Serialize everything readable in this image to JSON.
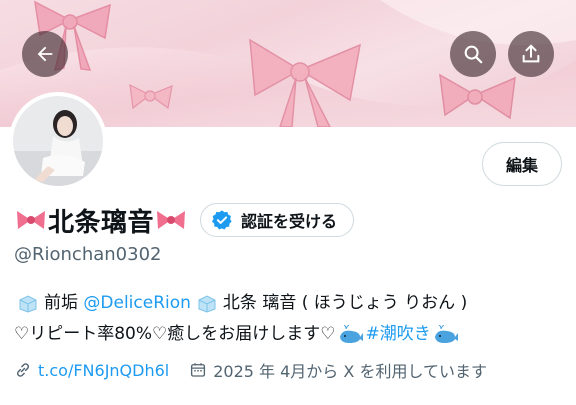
{
  "header": {
    "back_icon": "arrow-left-icon",
    "search_icon": "search-icon",
    "share_icon": "share-icon"
  },
  "profile": {
    "display_name": "北条璃音",
    "name_decoration_icon": "ribbon-bow-emoji",
    "edit_label": "編集",
    "verify_label": "認証を受ける",
    "handle": "@Rionchan0302"
  },
  "bio": {
    "line1_prefix": "前垢",
    "line1_mention": "@DeliceRion",
    "line1_suffix": "北条 璃音 ( ほうじょう りおん )",
    "line2_text": "♡リピート率80%♡癒しをお届けします♡",
    "line2_hashtag": "#潮吹き",
    "ice_emoji": "ice-cube-emoji",
    "whale_emoji": "whale-emoji"
  },
  "meta": {
    "link_text": "t.co/FN6JnQDh6l",
    "joined_text": "2025 年 4月から X を利用しています"
  },
  "colors": {
    "accent": "#1d9bf0",
    "secondary_text": "#536471",
    "banner_pink": "#f3d2da",
    "bow_pink": "#f2a7b8"
  }
}
